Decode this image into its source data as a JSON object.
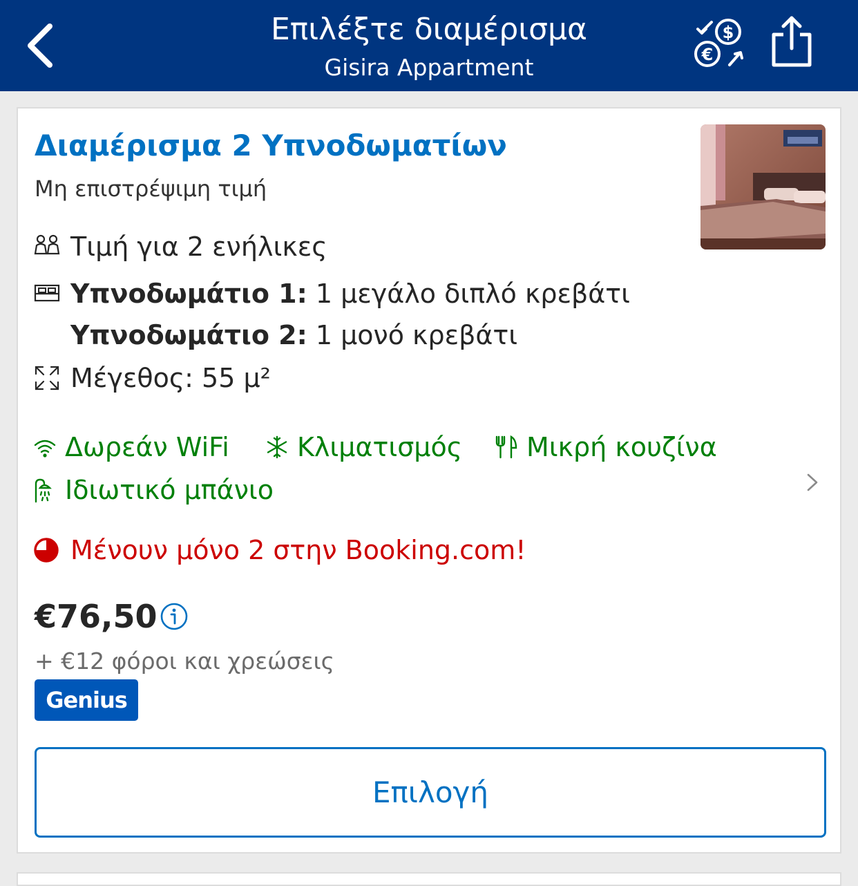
{
  "header": {
    "title": "Επιλέξτε διαμέρισμα",
    "subtitle": "Gisira Appartment"
  },
  "room": {
    "title": "Διαμέρισμα 2 Υπνοδωματίων",
    "policy": "Μη επιστρέψιμη τιμή",
    "occupancy": "Τιμή για 2 ενήλικες",
    "bedrooms": [
      {
        "label": "Υπνοδωμάτιο 1:",
        "beds": "1 μεγάλο διπλό κρεβάτι"
      },
      {
        "label": "Υπνοδωμάτιο 2:",
        "beds": "1 μονό κρεβάτι"
      }
    ],
    "size": "Μέγεθος: 55 μ²"
  },
  "amenities": {
    "wifi": "Δωρεάν WiFi",
    "ac": "Κλιματισμός",
    "kitchen": "Μικρή κουζίνα",
    "bathroom": "Ιδιωτικό μπάνιο"
  },
  "scarcity": "Μένουν μόνο 2 στην Booking.com!",
  "pricing": {
    "price": "€76,50",
    "taxes": "+ €12 φόροι και χρεώσεις",
    "badge": "Genius"
  },
  "select_button": "Επιλογή",
  "colors": {
    "header_bg": "#003580",
    "link_blue": "#0071c2",
    "amenity_green": "#008009",
    "scarcity_red": "#cc0000",
    "genius_blue": "#0057b8"
  }
}
